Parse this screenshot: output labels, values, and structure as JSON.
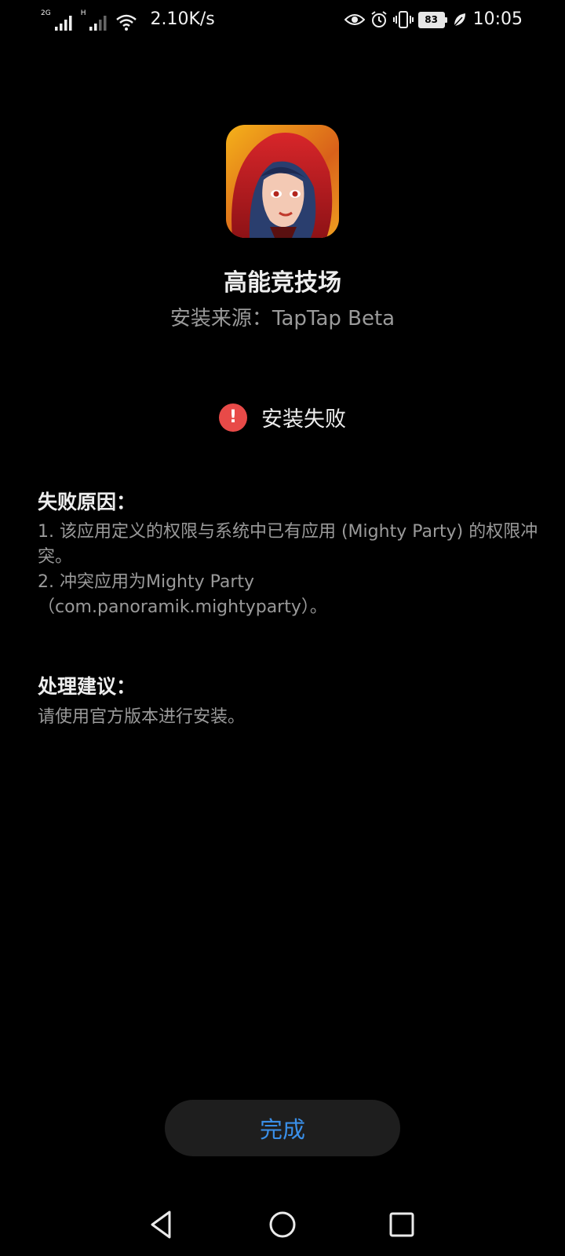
{
  "status_bar": {
    "network_1": "2G",
    "network_2": "H",
    "net_speed": "2.10K/s",
    "battery": "83",
    "time": "10:05",
    "icons": [
      "signal-icon",
      "signal-icon",
      "wifi-icon",
      "eye-icon",
      "alarm-icon",
      "vibrate-icon",
      "battery-icon",
      "leaf-icon"
    ]
  },
  "app": {
    "name": "高能竞技场",
    "install_source": "安装来源：TapTap Beta",
    "icon": "app-icon"
  },
  "result": {
    "icon": "error-icon",
    "icon_glyph": "!",
    "text": "安装失败",
    "icon_color": "#e84a48"
  },
  "failure_reason": {
    "title": "失败原因：",
    "line1": "1. 该应用定义的权限与系统中已有应用 (Mighty Party) 的权限冲突。",
    "line2": "2. 冲突应用为Mighty Party（com.panoramik.mightyparty）。"
  },
  "advice": {
    "title": "处理建议：",
    "body": "请使用官方版本进行安装。"
  },
  "done_button": {
    "label": "完成",
    "color": "#3a8fe8"
  },
  "nav_bar": {
    "icons": [
      "back-icon",
      "home-icon",
      "recents-icon"
    ]
  }
}
